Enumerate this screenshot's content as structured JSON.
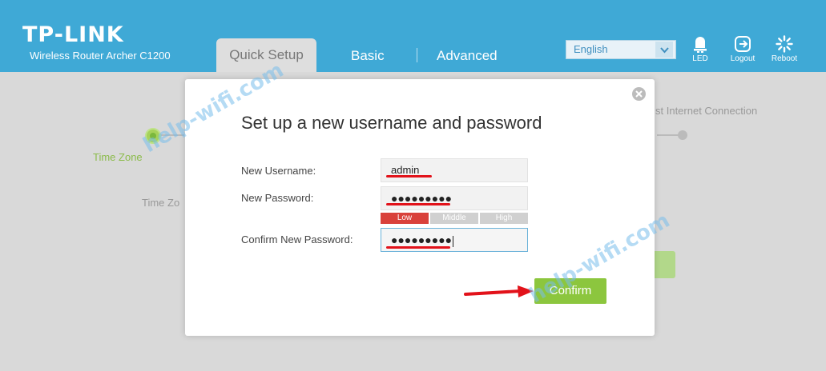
{
  "header": {
    "logo": "TP-LINK",
    "model": "Wireless Router Archer C1200",
    "tabs": [
      {
        "label": "Quick Setup",
        "active": true
      },
      {
        "label": "Basic",
        "active": false
      },
      {
        "label": "Advanced",
        "active": false
      }
    ],
    "language": {
      "selected": "English"
    },
    "buttons": {
      "led": "LED",
      "logout": "Logout",
      "reboot": "Reboot"
    }
  },
  "wizard": {
    "steps": {
      "time_zone": "Time Zone",
      "test_internet": "st Internet Connection"
    },
    "section_label": "Time Zo"
  },
  "dialog": {
    "title": "Set up a new username and password",
    "fields": {
      "username": {
        "label": "New Username:",
        "value": "admin"
      },
      "password": {
        "label": "New Password:",
        "value": "●●●●●●●●●"
      },
      "confirm_password": {
        "label": "Confirm New Password:",
        "value": "●●●●●●●●●"
      }
    },
    "strength": {
      "low": "Low",
      "middle": "Middle",
      "high": "High",
      "level": "Low"
    },
    "confirm_button": "Confirm"
  },
  "watermark": {
    "text1": "help-wifi.com",
    "text2": "help-wifi.com"
  },
  "colors": {
    "header": "#3fa9d6",
    "confirm": "#8cc63e",
    "strength_low": "#d9413b",
    "annotation": "#e2121a"
  }
}
